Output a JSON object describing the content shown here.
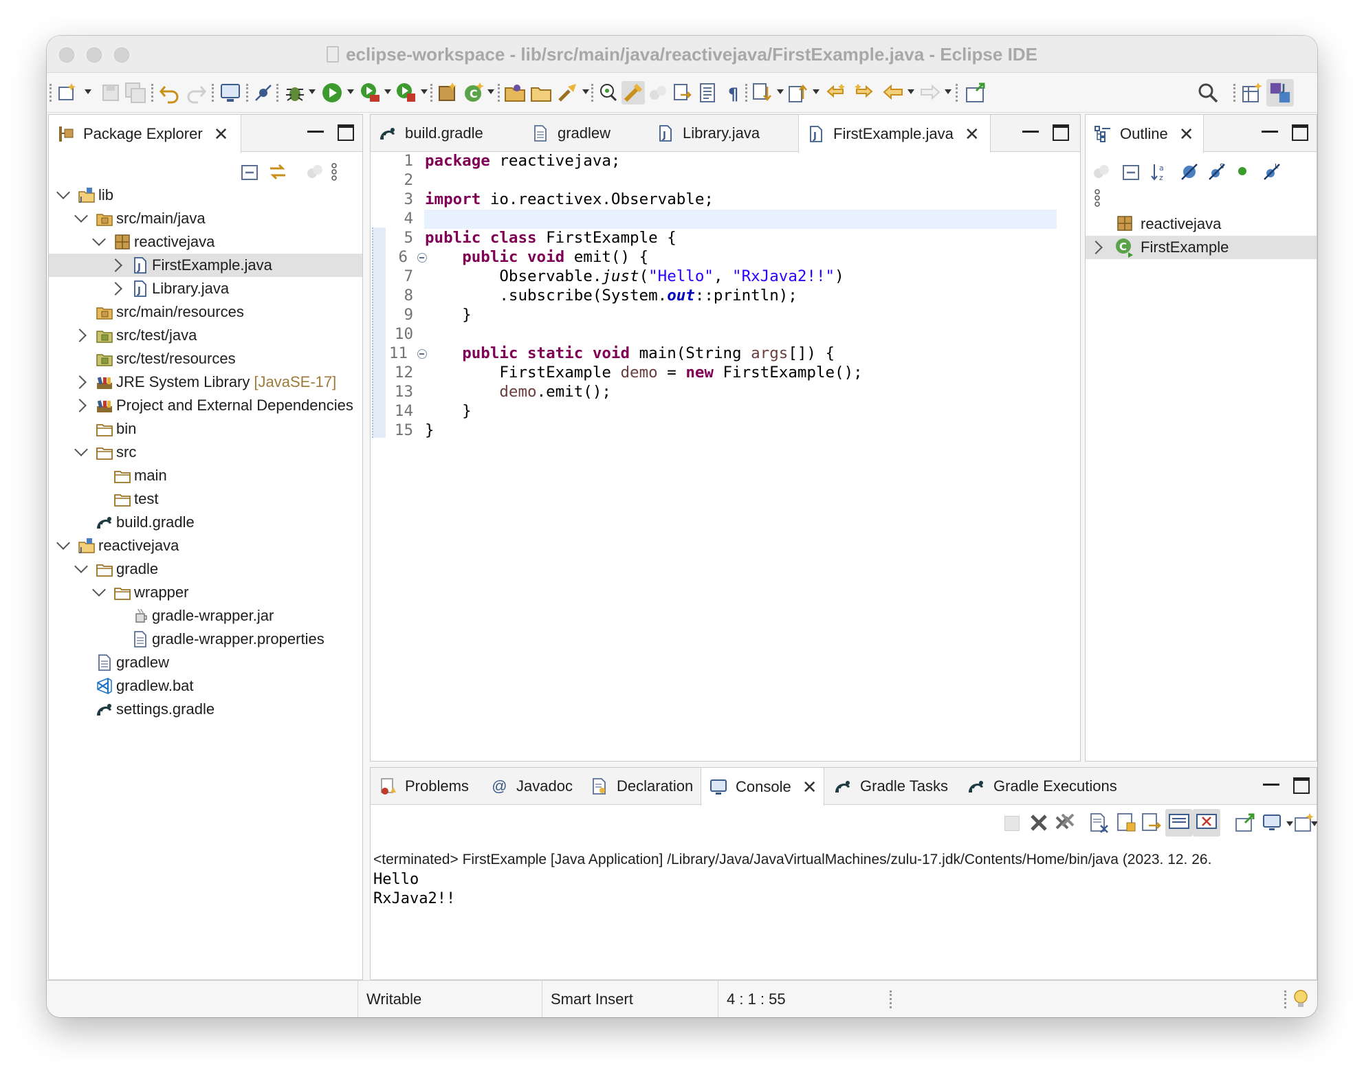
{
  "window": {
    "title": "eclipse-workspace - lib/src/main/java/reactivejava/FirstExample.java - Eclipse IDE"
  },
  "package_explorer": {
    "tab_label": "Package Explorer",
    "tree": [
      {
        "label": "lib",
        "kind": "project",
        "depth": 0,
        "expander": "down"
      },
      {
        "label": "src/main/java",
        "kind": "source-folder",
        "depth": 1,
        "expander": "down"
      },
      {
        "label": "reactivejava",
        "kind": "package",
        "depth": 2,
        "expander": "down"
      },
      {
        "label": "FirstExample.java",
        "kind": "java-file",
        "depth": 3,
        "expander": "right",
        "selected": true
      },
      {
        "label": "Library.java",
        "kind": "java-file",
        "depth": 3,
        "expander": "right"
      },
      {
        "label": "src/main/resources",
        "kind": "source-folder",
        "depth": 1,
        "expander": "none"
      },
      {
        "label": "src/test/java",
        "kind": "source-folder-test",
        "depth": 1,
        "expander": "right"
      },
      {
        "label": "src/test/resources",
        "kind": "source-folder-test",
        "depth": 1,
        "expander": "none"
      },
      {
        "label": "JRE System Library",
        "decoration": "[JavaSE-17]",
        "kind": "library",
        "depth": 1,
        "expander": "right"
      },
      {
        "label": "Project and External Dependencies",
        "kind": "library",
        "depth": 1,
        "expander": "right"
      },
      {
        "label": "bin",
        "kind": "folder",
        "depth": 1,
        "expander": "none"
      },
      {
        "label": "src",
        "kind": "folder",
        "depth": 1,
        "expander": "down"
      },
      {
        "label": "main",
        "kind": "folder",
        "depth": 2,
        "expander": "none"
      },
      {
        "label": "test",
        "kind": "folder",
        "depth": 2,
        "expander": "none"
      },
      {
        "label": "build.gradle",
        "kind": "gradle-file",
        "depth": 1,
        "expander": "none"
      },
      {
        "label": "reactivejava",
        "kind": "project",
        "depth": 0,
        "expander": "down"
      },
      {
        "label": "gradle",
        "kind": "folder",
        "depth": 1,
        "expander": "down"
      },
      {
        "label": "wrapper",
        "kind": "folder",
        "depth": 2,
        "expander": "down"
      },
      {
        "label": "gradle-wrapper.jar",
        "kind": "jar-file",
        "depth": 3,
        "expander": "none"
      },
      {
        "label": "gradle-wrapper.properties",
        "kind": "text-file",
        "depth": 3,
        "expander": "none"
      },
      {
        "label": "gradlew",
        "kind": "text-file",
        "depth": 1,
        "expander": "none"
      },
      {
        "label": "gradlew.bat",
        "kind": "bat-file",
        "depth": 1,
        "expander": "none"
      },
      {
        "label": "settings.gradle",
        "kind": "gradle-file",
        "depth": 1,
        "expander": "none"
      }
    ]
  },
  "editor": {
    "tabs": [
      {
        "label": "build.gradle",
        "icon": "gradle-icon"
      },
      {
        "label": "gradlew",
        "icon": "text-file-icon"
      },
      {
        "label": "Library.java",
        "icon": "java-file-icon"
      },
      {
        "label": "FirstExample.java",
        "icon": "java-file-icon",
        "active": true
      }
    ],
    "line_numbers": [
      "1",
      "2",
      "3",
      "4",
      "5",
      "6",
      "7",
      "8",
      "9",
      "10",
      "11",
      "12",
      "13",
      "14",
      "15"
    ],
    "code_tokens": {
      "l1_kw": "package",
      "l1_rest": " reactivejava;",
      "l3_kw": "import",
      "l3_rest": " io.reactivex.Observable;",
      "l5_kw": "public class",
      "l5_rest": " FirstExample {",
      "l6_indent": "    ",
      "l6_kw": "public void",
      "l6_rest": " emit() {",
      "l7_a": "        Observable.",
      "l7_method": "just",
      "l7_b": "(",
      "l7_s1": "\"Hello\"",
      "l7_c": ", ",
      "l7_s2": "\"RxJava2!!\"",
      "l7_d": ")",
      "l8_a": "        .subscribe(System.",
      "l8_field": "out",
      "l8_b": "::println);",
      "l9": "    }",
      "l11_indent": "    ",
      "l11_kw": "public static void",
      "l11_a": " main(String ",
      "l11_var": "args",
      "l11_b": "[]) {",
      "l12_a": "        FirstExample ",
      "l12_var": "demo",
      "l12_b": " = ",
      "l12_kw": "new",
      "l12_c": " FirstExample();",
      "l13_indent": "        ",
      "l13_var": "demo",
      "l13_b": ".emit();",
      "l14": "    }",
      "l15": "}"
    }
  },
  "outline": {
    "tab_label": "Outline",
    "items": [
      {
        "label": "reactivejava",
        "kind": "package"
      },
      {
        "label": "FirstExample",
        "kind": "class",
        "selected": true
      }
    ]
  },
  "bottom_panel": {
    "tabs": [
      {
        "label": "Problems",
        "icon": "problems-icon"
      },
      {
        "label": "Javadoc",
        "icon": "at-icon"
      },
      {
        "label": "Declaration",
        "icon": "declaration-icon"
      },
      {
        "label": "Console",
        "icon": "console-icon",
        "active": true
      },
      {
        "label": "Gradle Tasks",
        "icon": "gradle-icon"
      },
      {
        "label": "Gradle Executions",
        "icon": "gradle-icon"
      }
    ],
    "console": {
      "header": "<terminated> FirstExample [Java Application] /Library/Java/JavaVirtualMachines/zulu-17.jdk/Contents/Home/bin/java  (2023. 12. 26.",
      "output": [
        "Hello",
        "RxJava2!!"
      ]
    }
  },
  "status_bar": {
    "writable": "Writable",
    "insert_mode": "Smart Insert",
    "position": "4 : 1 : 55"
  },
  "colors": {
    "keyword": "#7f0055",
    "string": "#2a00ff",
    "local_var": "#6a3e3e",
    "static_field": "#0000c0",
    "current_line": "#e8f2fe",
    "selection": "#e1e1e1"
  }
}
